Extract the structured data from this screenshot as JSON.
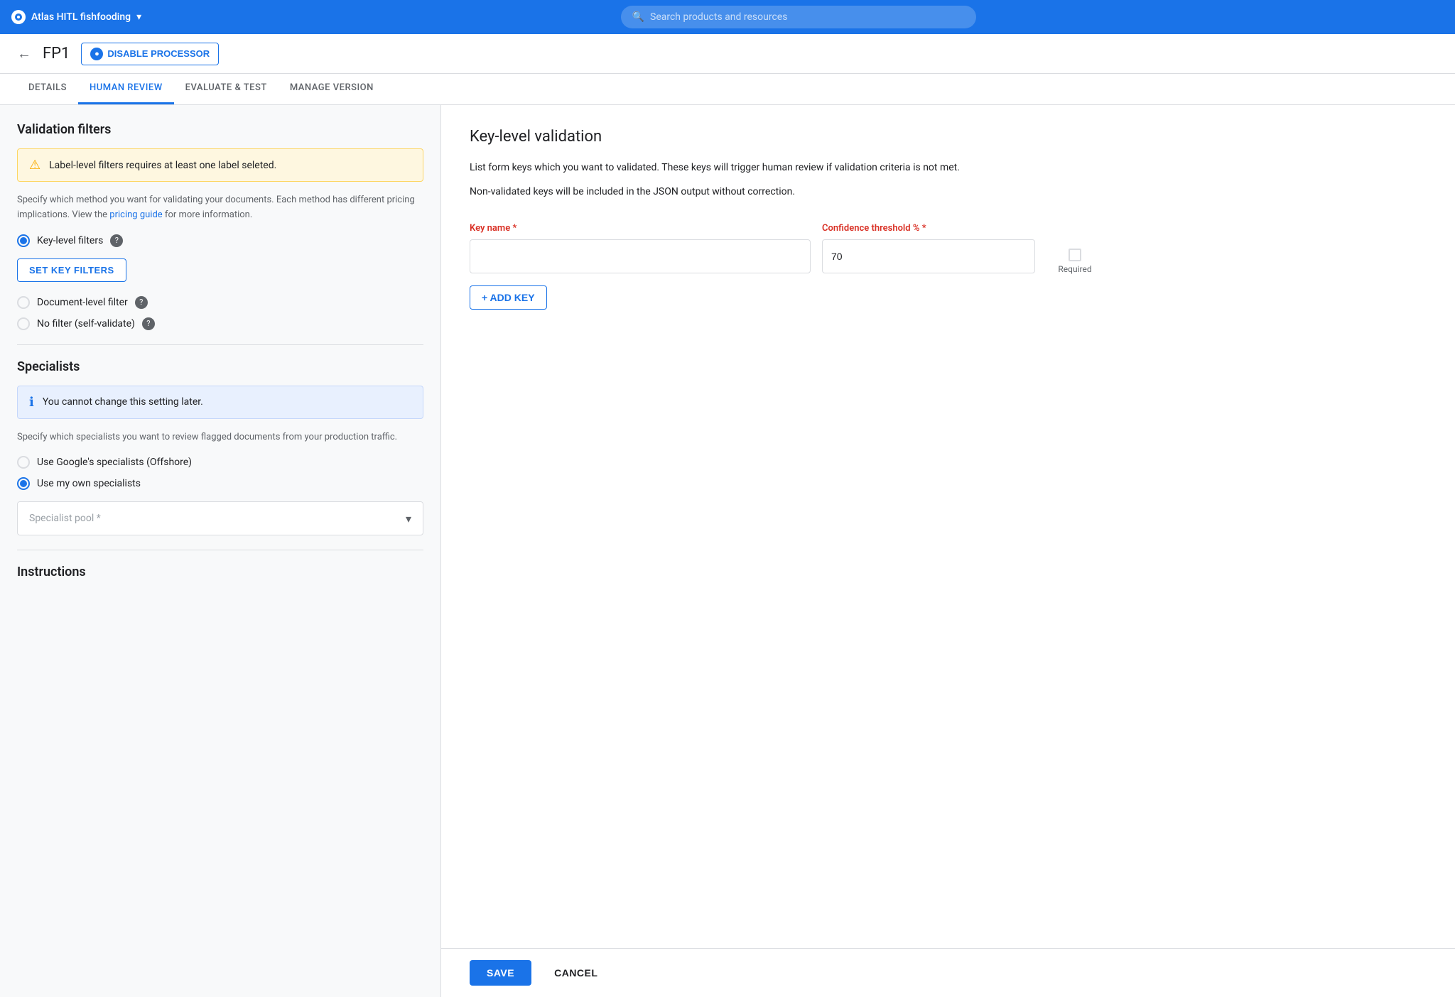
{
  "topbar": {
    "app_name": "Atlas HITL fishfooding",
    "search_placeholder": "Search products and resources",
    "dropdown_icon": "▾"
  },
  "subheader": {
    "back_label": "←",
    "page_title": "FP1",
    "disable_button_label": "DISABLE PROCESSOR",
    "disable_icon": "●"
  },
  "tabs": [
    {
      "id": "details",
      "label": "DETAILS",
      "active": false
    },
    {
      "id": "human-review",
      "label": "HUMAN REVIEW",
      "active": true
    },
    {
      "id": "evaluate-test",
      "label": "EVALUATE & TEST",
      "active": false
    },
    {
      "id": "manage-version",
      "label": "MANAGE VERSION",
      "active": false
    }
  ],
  "left_panel": {
    "validation_filters_title": "Validation filters",
    "warning_text": "Label-level filters requires at least one label seleted.",
    "description": "Specify which method you want for validating your documents. Each method has different pricing implications. View the",
    "pricing_link_text": "pricing guide",
    "description_end": "for more information.",
    "key_level_filter_label": "Key-level filters",
    "set_filters_button": "SET KEY FILTERS",
    "document_level_filter_label": "Document-level filter",
    "no_filter_label": "No filter (self-validate)",
    "specialists_title": "Specialists",
    "specialists_info": "You cannot change this setting later.",
    "specialists_description": "Specify which specialists you want to review flagged documents from your production traffic.",
    "google_specialists_label": "Use Google's specialists (Offshore)",
    "own_specialists_label": "Use my own specialists",
    "specialist_pool_placeholder": "Specialist pool *",
    "instructions_label": "Instructions"
  },
  "right_panel": {
    "title": "Key-level validation",
    "description1": "List form keys which you want to validated. These keys will trigger human review if validation criteria is not met.",
    "description2": "Non-validated keys will be included in the JSON output without correction.",
    "key_name_label": "Key name",
    "key_name_required": "*",
    "confidence_label": "Confidence threshold %",
    "confidence_required": "*",
    "confidence_default": "70",
    "required_label": "Required",
    "add_key_label": "+ ADD KEY",
    "save_button": "SAVE",
    "cancel_button": "CANCEL"
  }
}
